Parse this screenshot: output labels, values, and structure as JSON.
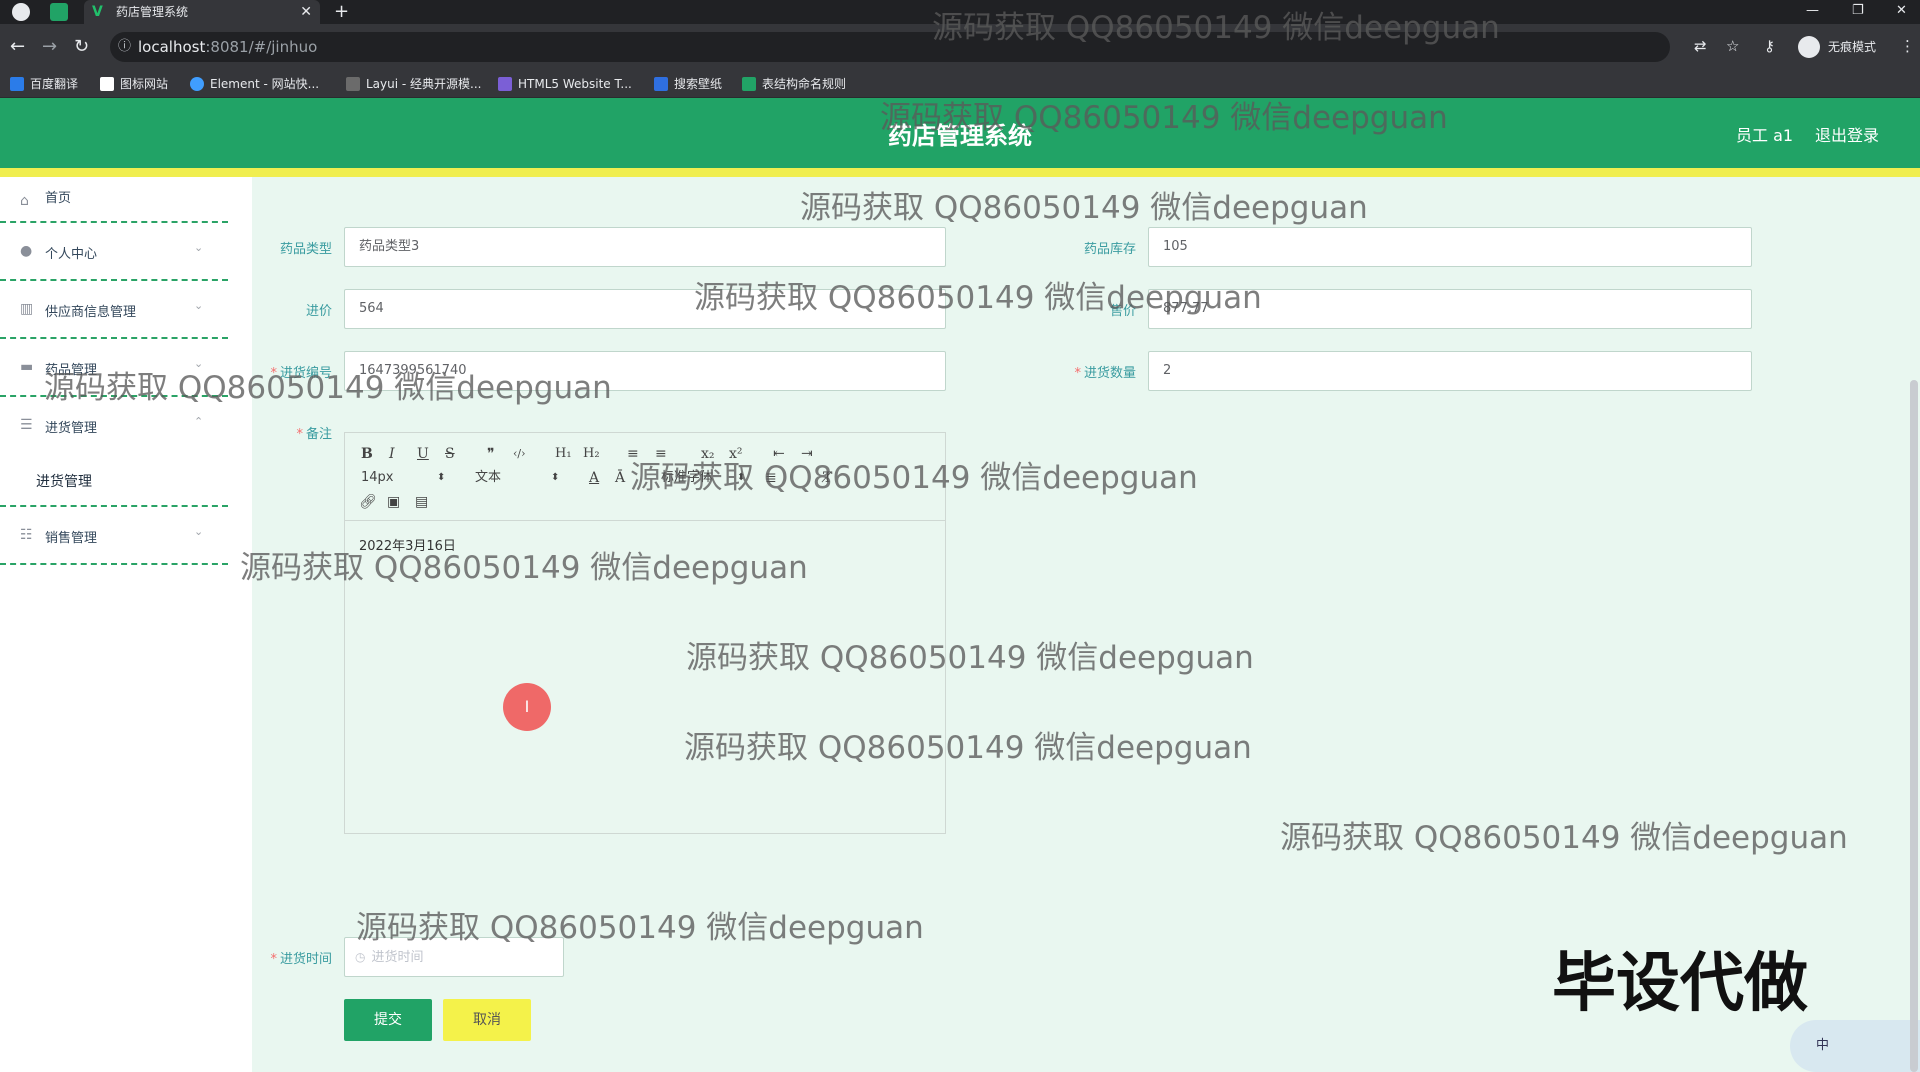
{
  "browser": {
    "tab_title": "药店管理系统",
    "tab_close": "✕",
    "new_tab": "+",
    "url_host": "localhost",
    "url_rest": ":8081/#/jinhuo",
    "incognito_label": "无痕模式",
    "bookmarks": [
      "百度翻译",
      "图标网站",
      "Element - 网站快...",
      "Layui - 经典开源模...",
      "HTML5 Website T...",
      "搜索壁纸",
      "表结构命名规则"
    ]
  },
  "header": {
    "title": "药店管理系统",
    "user": "员工 a1",
    "logout": "退出登录"
  },
  "sidebar": {
    "items": [
      {
        "label": "首页",
        "icon": "home-icon"
      },
      {
        "label": "个人中心",
        "icon": "user-icon"
      },
      {
        "label": "供应商信息管理",
        "icon": "chart-icon"
      },
      {
        "label": "药品管理",
        "icon": "monitor-icon"
      },
      {
        "label": "进货管理",
        "icon": "menu-icon"
      },
      {
        "label": "销售管理",
        "icon": "sliders-icon"
      }
    ],
    "submenu_item": "进货管理"
  },
  "form": {
    "drug_type_label": "药品类型",
    "drug_type_value": "药品类型3",
    "stock_label": "药品库存",
    "stock_value": "105",
    "purchase_price_label": "进价",
    "purchase_price_value": "564",
    "sale_price_label": "售价",
    "sale_price_value": "877.77",
    "purchase_no_label": "进货编号",
    "purchase_no_value": "1647399561740",
    "quantity_label": "进货数量",
    "quantity_value": "2",
    "remark_label": "备注",
    "editor_font_size": "14px",
    "editor_text_type": "文本",
    "editor_font_family": "标准字体",
    "editor_content": "2022年3月16日",
    "purchase_time_label": "进货时间",
    "purchase_time_placeholder": "进货时间",
    "submit": "提交",
    "cancel": "取消"
  },
  "overlays": {
    "watermark_text": "源码获取 QQ86050149 微信deepguan",
    "stamp_text": "毕设代做",
    "ime_text": "中"
  },
  "colors": {
    "header_green": "#21a366",
    "accent_yellow": "#f0ee4f",
    "content_bg": "#e9f7f0"
  }
}
